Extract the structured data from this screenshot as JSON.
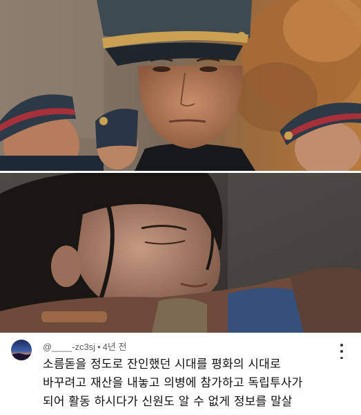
{
  "comment": {
    "author": "@____-zc3sj",
    "separator": "•",
    "time": "4년 전",
    "lines": [
      "소름돋을 정도로 잔인했던 시대를 평화의 시대로",
      "바꾸려고 재산을 내놓고 의병에 참가하고 독립투사가",
      "되어 활동 하시다가 신원도 알 수 없게 정보를 말살"
    ]
  },
  "icons": {
    "menu": "more-vert-icon",
    "avatar": "profile-avatar"
  },
  "colors": {
    "meta_text": "#606060",
    "body_text": "#0f0f0f",
    "background": "#ffffff"
  }
}
